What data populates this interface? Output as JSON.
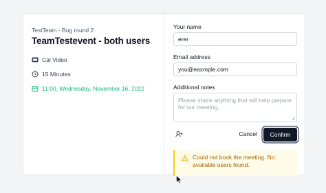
{
  "event": {
    "team": "TestTeam - Bug round 2",
    "title": "TeamTestevent - both users",
    "location": "Cal Video",
    "duration": "15 Minutes",
    "datetime": "11:00, Wednesday, November 16, 2022"
  },
  "form": {
    "name_label": "Your name",
    "name_value": "erer",
    "email_label": "Email address",
    "email_value": "you@eaxmple.com",
    "notes_label": "Additional notes",
    "notes_placeholder": "Please share anything that will help prepare for our meeting."
  },
  "actions": {
    "cancel_label": "Cancel",
    "confirm_label": "Confirm"
  },
  "alert": {
    "message": "Could not book the meeting. No available users found."
  },
  "icons": {
    "location": "video-icon",
    "duration": "clock-icon",
    "datetime": "calendar-icon",
    "guests": "add-guest-icon",
    "alert": "warning-icon"
  },
  "colors": {
    "accent_green": "#10b981",
    "primary_button": "#111827",
    "alert_bg": "#fefce8",
    "alert_border": "#facc15",
    "alert_text": "#a16207"
  }
}
